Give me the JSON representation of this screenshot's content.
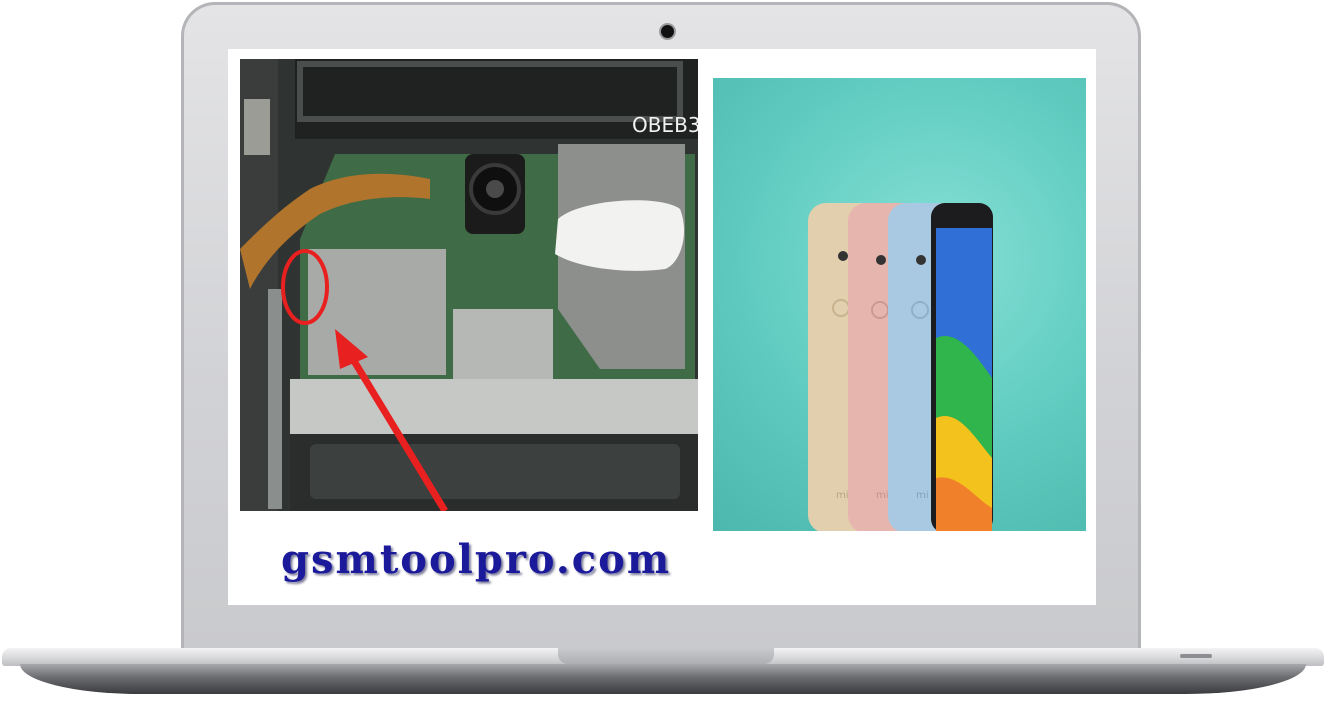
{
  "image": {
    "caption_text": "gsmtoolpro.com",
    "board_marking": "OBEB3",
    "phone_logo": "mi",
    "colors": {
      "laptop_frame": "#d6d7da",
      "background_teal": "#5fcbc0",
      "text_blue": "#1a1a9a",
      "marker_red": "#e8201f",
      "board_green": "#3f6b46",
      "phone_gold": "#e2cfae",
      "phone_pink": "#e6b5ad",
      "phone_blue": "#a9c9e3",
      "phone_black": "#1c1c1e"
    }
  }
}
